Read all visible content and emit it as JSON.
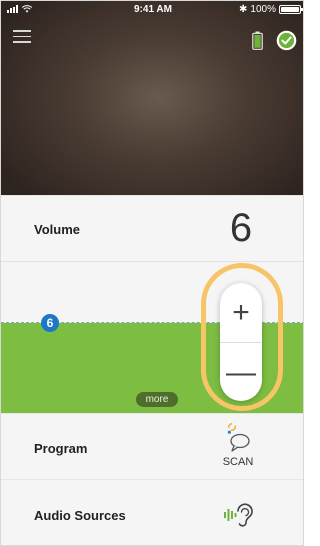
{
  "status_bar": {
    "time": "9:41 AM",
    "battery_percent": "100%",
    "bluetooth_glyph": "✱"
  },
  "header": {
    "menu_icon": "hamburger-menu-icon",
    "hearing_aid_battery_icon": "battery-full-icon",
    "connection_status_icon": "check-circle-icon",
    "colors": {
      "accent_green": "#7cbd42",
      "connected_green": "#6db23a"
    }
  },
  "volume": {
    "label": "Volume",
    "value": "6",
    "level_badge": "6",
    "plus_glyph": "+",
    "minus_glyph": "—",
    "more_label": "more"
  },
  "program": {
    "label": "Program",
    "current": "SCAN",
    "icon": "scan-speech-bubble-icon"
  },
  "audio_sources": {
    "label": "Audio Sources",
    "icon": "ear-stream-icon"
  }
}
